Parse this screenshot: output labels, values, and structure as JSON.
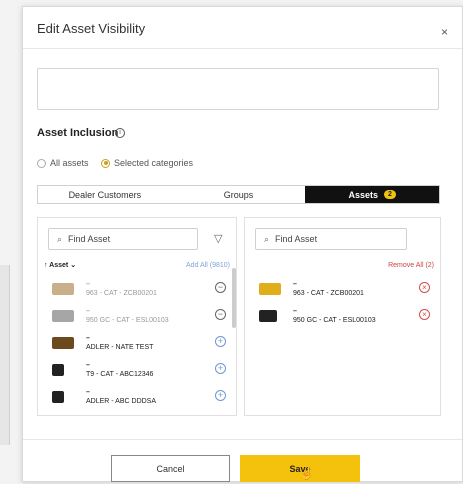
{
  "modal": {
    "title": "Edit Asset Visibility",
    "close_icon": "×"
  },
  "inclusion": {
    "title": "Asset Inclusion",
    "info_icon": "i",
    "options": [
      {
        "label": "All assets",
        "checked": false
      },
      {
        "label": "Selected categories",
        "checked": true
      }
    ]
  },
  "tabs": [
    {
      "label": "Dealer Customers",
      "active": false
    },
    {
      "label": "Groups",
      "active": false
    },
    {
      "label": "Assets",
      "active": true,
      "badge": "2"
    }
  ],
  "left_panel": {
    "search_placeholder": "Find Asset",
    "sort_label": "↑ Asset ⌄",
    "add_all_label": "Add All (9810)",
    "items": [
      {
        "name": "963 - CAT - ZCB00201",
        "muted": true,
        "action": "minus"
      },
      {
        "name": "950 GC - CAT - ESL00103",
        "muted": true,
        "action": "minus"
      },
      {
        "name": "ADLER - NATE TEST",
        "muted": false,
        "action": "plus"
      },
      {
        "name": "T9 - CAT - ABC12346",
        "muted": false,
        "action": "plus"
      },
      {
        "name": "ADLER - ABC DDDSA",
        "muted": false,
        "action": "plus"
      }
    ]
  },
  "right_panel": {
    "search_placeholder": "Find Asset",
    "remove_all_label": "Remove All (2)",
    "items": [
      {
        "name": "963 - CAT - ZCB00201"
      },
      {
        "name": "950 GC - CAT - ESL00103"
      }
    ]
  },
  "footer": {
    "cancel_label": "Cancel",
    "save_label": "Save"
  },
  "colors": {
    "accent": "#f4c20d",
    "remove": "#d34e4e",
    "add": "#6e97d3"
  }
}
